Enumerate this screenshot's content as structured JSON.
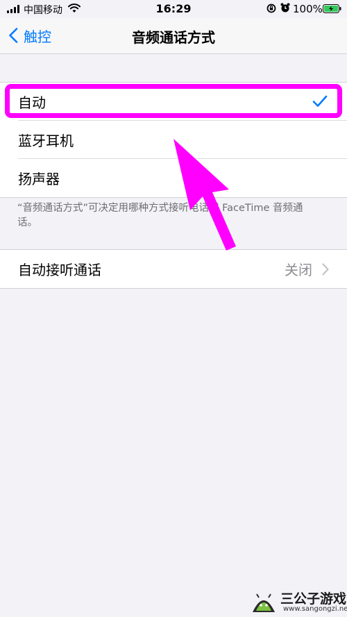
{
  "status_bar": {
    "carrier": "中国移动",
    "time": "16:29",
    "battery_percent": "100%",
    "icons": [
      "signal-icon",
      "wifi-icon",
      "rotation-lock-icon",
      "alarm-icon",
      "battery-charging-icon"
    ]
  },
  "nav": {
    "back_label": "触控",
    "title": "音频通话方式"
  },
  "options": [
    {
      "label": "自动",
      "selected": true
    },
    {
      "label": "蓝牙耳机",
      "selected": false
    },
    {
      "label": "扬声器",
      "selected": false
    }
  ],
  "footer_note": "“音频通话方式”可决定用哪种方式接听电话或 FaceTime 音频通话。",
  "auto_answer": {
    "label": "自动接听通话",
    "value": "关闭"
  },
  "watermark": {
    "title": "三公子游戏网",
    "url": "www.sangongzi.net"
  },
  "colors": {
    "accent": "#007aff",
    "highlight": "#ff00ff",
    "background": "#f2f2f7"
  }
}
